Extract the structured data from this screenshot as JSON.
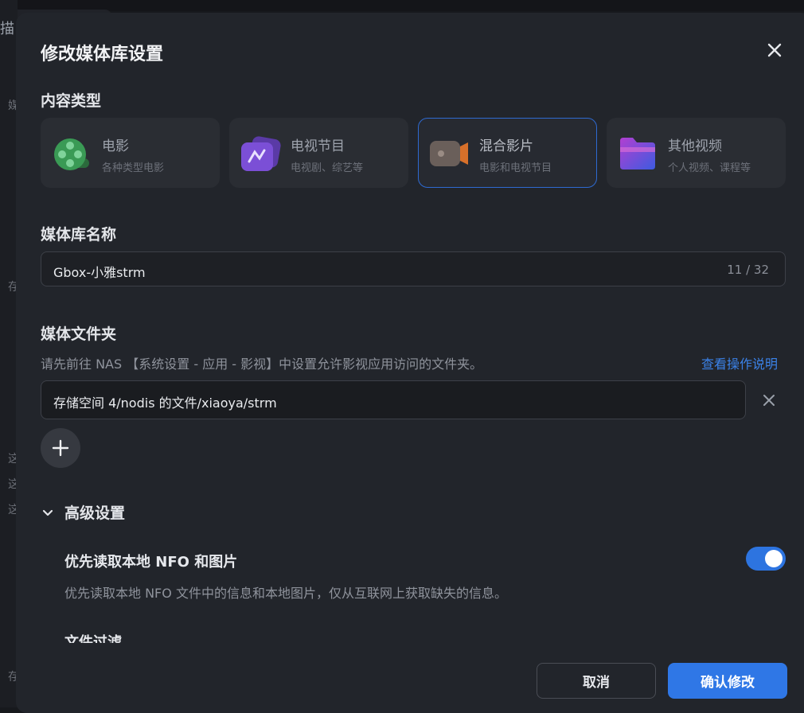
{
  "background": {
    "tab_fragment": "描",
    "side_chars": [
      "媒",
      "存",
      "这",
      "这",
      "这",
      "存"
    ]
  },
  "dialog": {
    "title": "修改媒体库设置",
    "close_icon": "close-icon"
  },
  "content_type": {
    "label": "内容类型",
    "options": [
      {
        "name": "电影",
        "desc": "各种类型电影",
        "icon": "film-reel-icon",
        "color": "#3aa356",
        "selected": false
      },
      {
        "name": "电视节目",
        "desc": "电视剧、综艺等",
        "icon": "tv-icon",
        "color": "#7b4fd6",
        "selected": false
      },
      {
        "name": "混合影片",
        "desc": "电影和电视节目",
        "icon": "video-camera-icon",
        "color": "#e07a2e",
        "selected": true
      },
      {
        "name": "其他视频",
        "desc": "个人视频、课程等",
        "icon": "folder-icon",
        "color": "#c44cc9",
        "selected": false
      }
    ]
  },
  "library_name": {
    "label": "媒体库名称",
    "value": "Gbox-小雅strm",
    "counter": "11 / 32"
  },
  "media_folder": {
    "label": "媒体文件夹",
    "hint": "请先前往 NAS 【系统设置 - 应用 - 影视】中设置允许影视应用访问的文件夹。",
    "help_link": "查看操作说明",
    "folders": [
      "存储空间 4/nodis 的文件/xiaoya/strm"
    ],
    "add_icon": "plus-icon",
    "remove_icon": "close-icon"
  },
  "advanced": {
    "label": "高级设置",
    "expanded": true,
    "prefer_local": {
      "title": "优先读取本地 NFO 和图片",
      "desc": "优先读取本地 NFO 文件中的信息和本地图片，仅从互联网上获取缺失的信息。",
      "enabled": true
    },
    "file_filter_title": "文件过滤"
  },
  "footer": {
    "cancel": "取消",
    "confirm": "确认修改"
  },
  "colors": {
    "accent": "#2f77e6",
    "dialog_bg": "#22252b",
    "selected_border": "#2e6ad1"
  }
}
